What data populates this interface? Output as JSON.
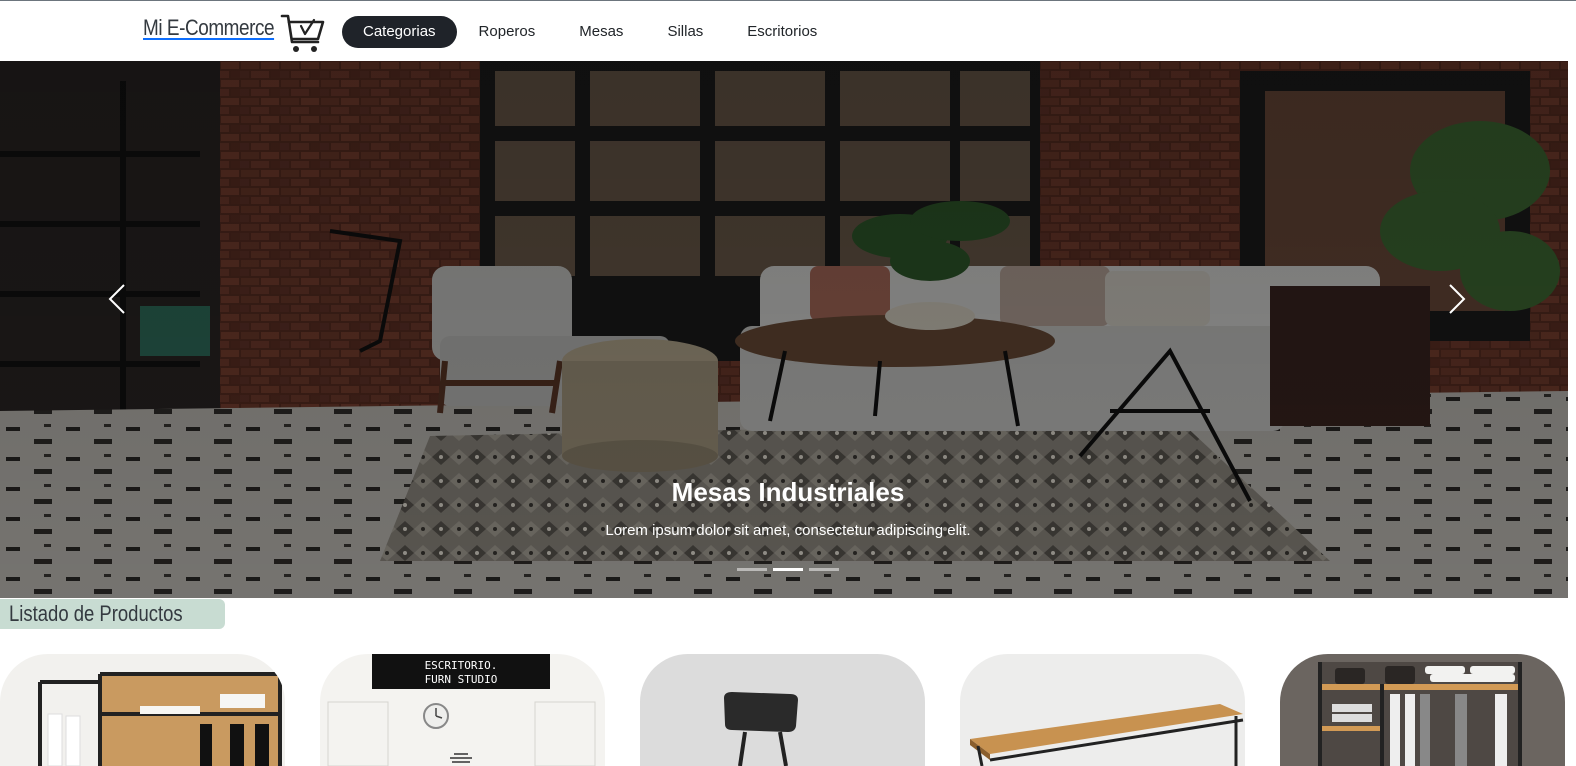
{
  "brand": {
    "name": "Mi E-Commerce",
    "icon": "shopping-cart-icon"
  },
  "nav": {
    "items": [
      {
        "label": "Categorias",
        "active": true
      },
      {
        "label": "Roperos",
        "active": false
      },
      {
        "label": "Mesas",
        "active": false
      },
      {
        "label": "Sillas",
        "active": false
      },
      {
        "label": "Escritorios",
        "active": false
      }
    ]
  },
  "carousel": {
    "slide": {
      "title": "Mesas Industriales",
      "text": "Lorem ipsum dolor sit amet, consectetur adipiscing elit."
    },
    "indicator_count": 3,
    "active_indicator": 2,
    "prev_icon": "chevron-left-icon",
    "next_icon": "chevron-right-icon"
  },
  "products": {
    "title": "Listado de Productos",
    "cards": [
      {
        "image": "wardrobe-rack-image"
      },
      {
        "image": "desk-studio-image",
        "sign_text": [
          "ESCRITORIO.",
          "FURN STUDIO"
        ]
      },
      {
        "image": "chair-image"
      },
      {
        "image": "console-table-image"
      },
      {
        "image": "shelving-unit-image"
      }
    ]
  },
  "colors": {
    "nav_active_bg": "#1f2329",
    "section_title_bg": "#c8dcd2",
    "brand_underline": "#0d6efd"
  }
}
